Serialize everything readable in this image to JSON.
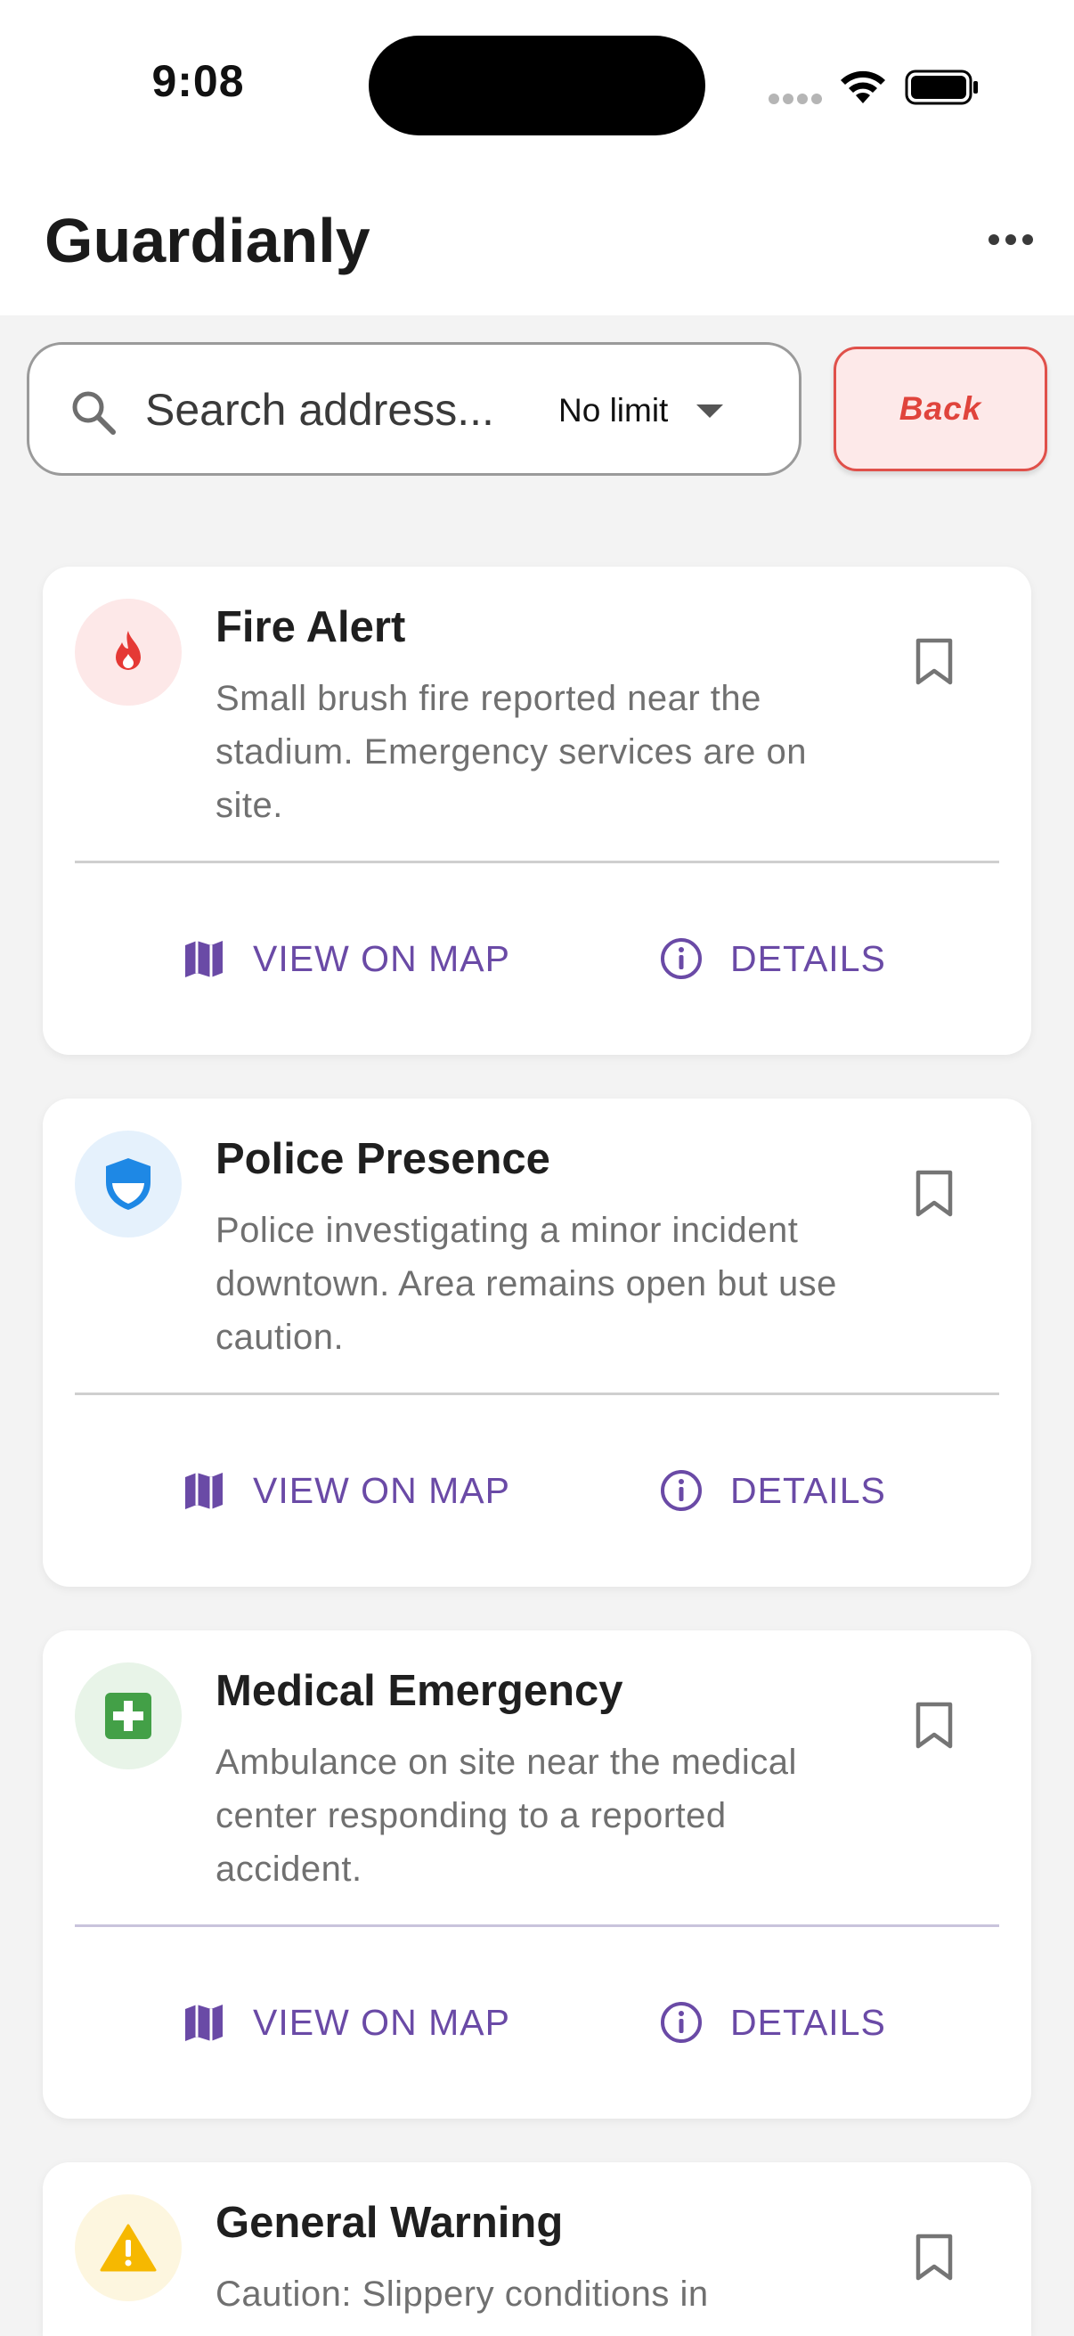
{
  "status_bar": {
    "time": "9:08"
  },
  "header": {
    "title": "Guardianly",
    "more_icon": "more-horizontal-icon"
  },
  "search": {
    "placeholder": "Search address...",
    "value": "",
    "limit_selected": "No limit"
  },
  "back_button": {
    "label": "Back"
  },
  "actions": {
    "map_label": "VIEW ON MAP",
    "details_label": "DETAILS"
  },
  "alerts": [
    {
      "icon": "fire-icon",
      "accent": "#e53935",
      "icon_bg": "#fde8e8",
      "title": "Fire Alert",
      "description": "Small brush fire reported near the stadium. Emergency services are on site."
    },
    {
      "icon": "shield-icon",
      "accent": "#1e88e5",
      "icon_bg": "#e5f1fc",
      "title": "Police Presence",
      "description": "Police investigating a minor incident downtown. Area remains open but use caution."
    },
    {
      "icon": "medical-cross-icon",
      "accent": "#43a047",
      "icon_bg": "#e8f4e8",
      "title": "Medical Emergency",
      "description": "Ambulance on site near the medical center responding to a reported accident."
    },
    {
      "icon": "warning-icon",
      "accent": "#f6b800",
      "icon_bg": "#fdf6df",
      "title": "General Warning",
      "description": "Caution: Slippery conditions in"
    }
  ],
  "colors": {
    "action": "#6a4aa6",
    "back_border": "#e0504a",
    "back_bg": "#fde9e9"
  }
}
